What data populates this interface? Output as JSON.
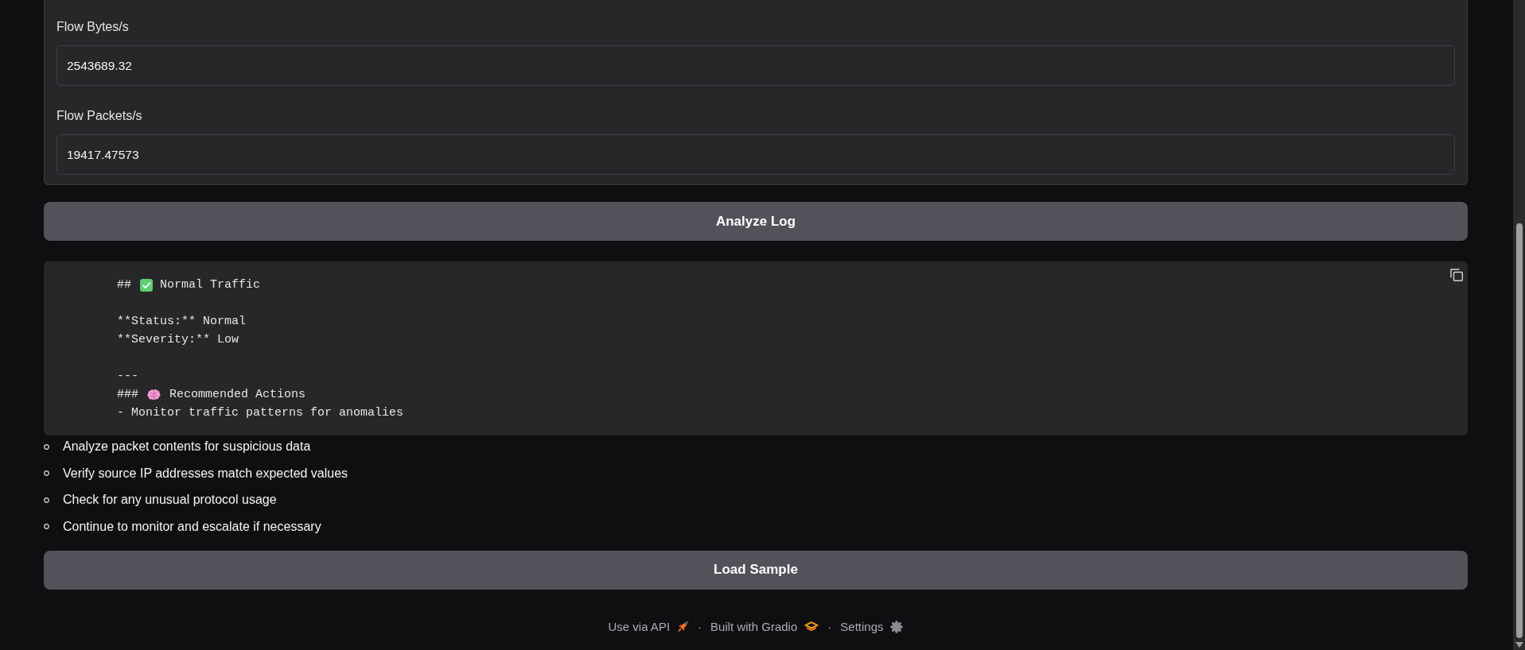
{
  "form": {
    "fields": [
      {
        "label": "Flow Bytes/s",
        "value": "2543689.32"
      },
      {
        "label": "Flow Packets/s",
        "value": "19417.47573"
      }
    ]
  },
  "analyze_button": {
    "label": "Analyze Log"
  },
  "output": {
    "lines": [
      {
        "kind": "title",
        "marker": "##",
        "text": "Normal Traffic"
      },
      {
        "kind": "blank"
      },
      {
        "kind": "text",
        "text": "**Status:** Normal"
      },
      {
        "kind": "text",
        "text": "**Severity:** Low"
      },
      {
        "kind": "blank"
      },
      {
        "kind": "text",
        "text": "---"
      },
      {
        "kind": "section",
        "marker": "###",
        "text": "Recommended Actions"
      },
      {
        "kind": "text",
        "text": "- Monitor traffic patterns for anomalies"
      }
    ]
  },
  "action_list": [
    "Analyze packet contents for suspicious data",
    "Verify source IP addresses match expected values",
    "Check for any unusual protocol usage",
    "Continue to monitor and escalate if necessary"
  ],
  "sample_button": {
    "label": "Load Sample"
  },
  "footer": {
    "items": [
      {
        "kind": "api",
        "label": "Use via API"
      },
      {
        "kind": "separator",
        "label": "·"
      },
      {
        "kind": "gradio",
        "label": "Built with Gradio"
      },
      {
        "kind": "separator",
        "label": "·"
      },
      {
        "kind": "settings",
        "label": "Settings"
      }
    ]
  }
}
